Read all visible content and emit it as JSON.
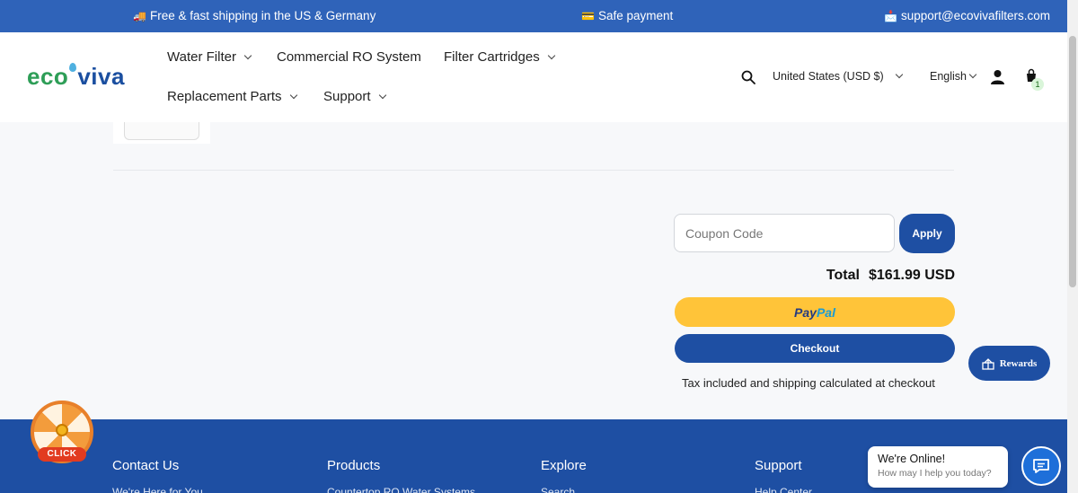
{
  "announcement": {
    "shipping": "Free & fast shipping in the US & Germany",
    "payment": "Safe payment",
    "email": "support@ecovivafilters.com"
  },
  "header": {
    "logo_part1": "eco",
    "logo_part2": "viva",
    "nav": [
      "Water Filter",
      "Commercial RO System",
      "Filter Cartridges",
      "Replacement Parts",
      "Support"
    ],
    "currency": "United States (USD $)",
    "language": "English",
    "cart_count": "1"
  },
  "cart": {
    "coupon_placeholder": "Coupon Code",
    "apply_label": "Apply",
    "total_label": "Total",
    "total_value": "$161.99 USD",
    "paypal_part1": "Pay",
    "paypal_part2": "Pal",
    "checkout_label": "Checkout",
    "tax_note": "Tax included and shipping calculated at checkout"
  },
  "widgets": {
    "rewards_label": "Rewards",
    "spin_label": "CLICK",
    "chat_title": "We're Online!",
    "chat_subtitle": "How may I help you today?"
  },
  "footer": {
    "columns": [
      {
        "heading": "Contact Us",
        "link": "We're Here for You"
      },
      {
        "heading": "Products",
        "link": "Countertop RO Water Systems"
      },
      {
        "heading": "Explore",
        "link": "Search"
      },
      {
        "heading": "Support",
        "link": "Help Center"
      }
    ]
  },
  "colors": {
    "brand_blue": "#1e4fa3",
    "topbar_blue": "#2f63b9",
    "paypal_yellow": "#ffc439",
    "logo_green": "#2e9e57"
  }
}
